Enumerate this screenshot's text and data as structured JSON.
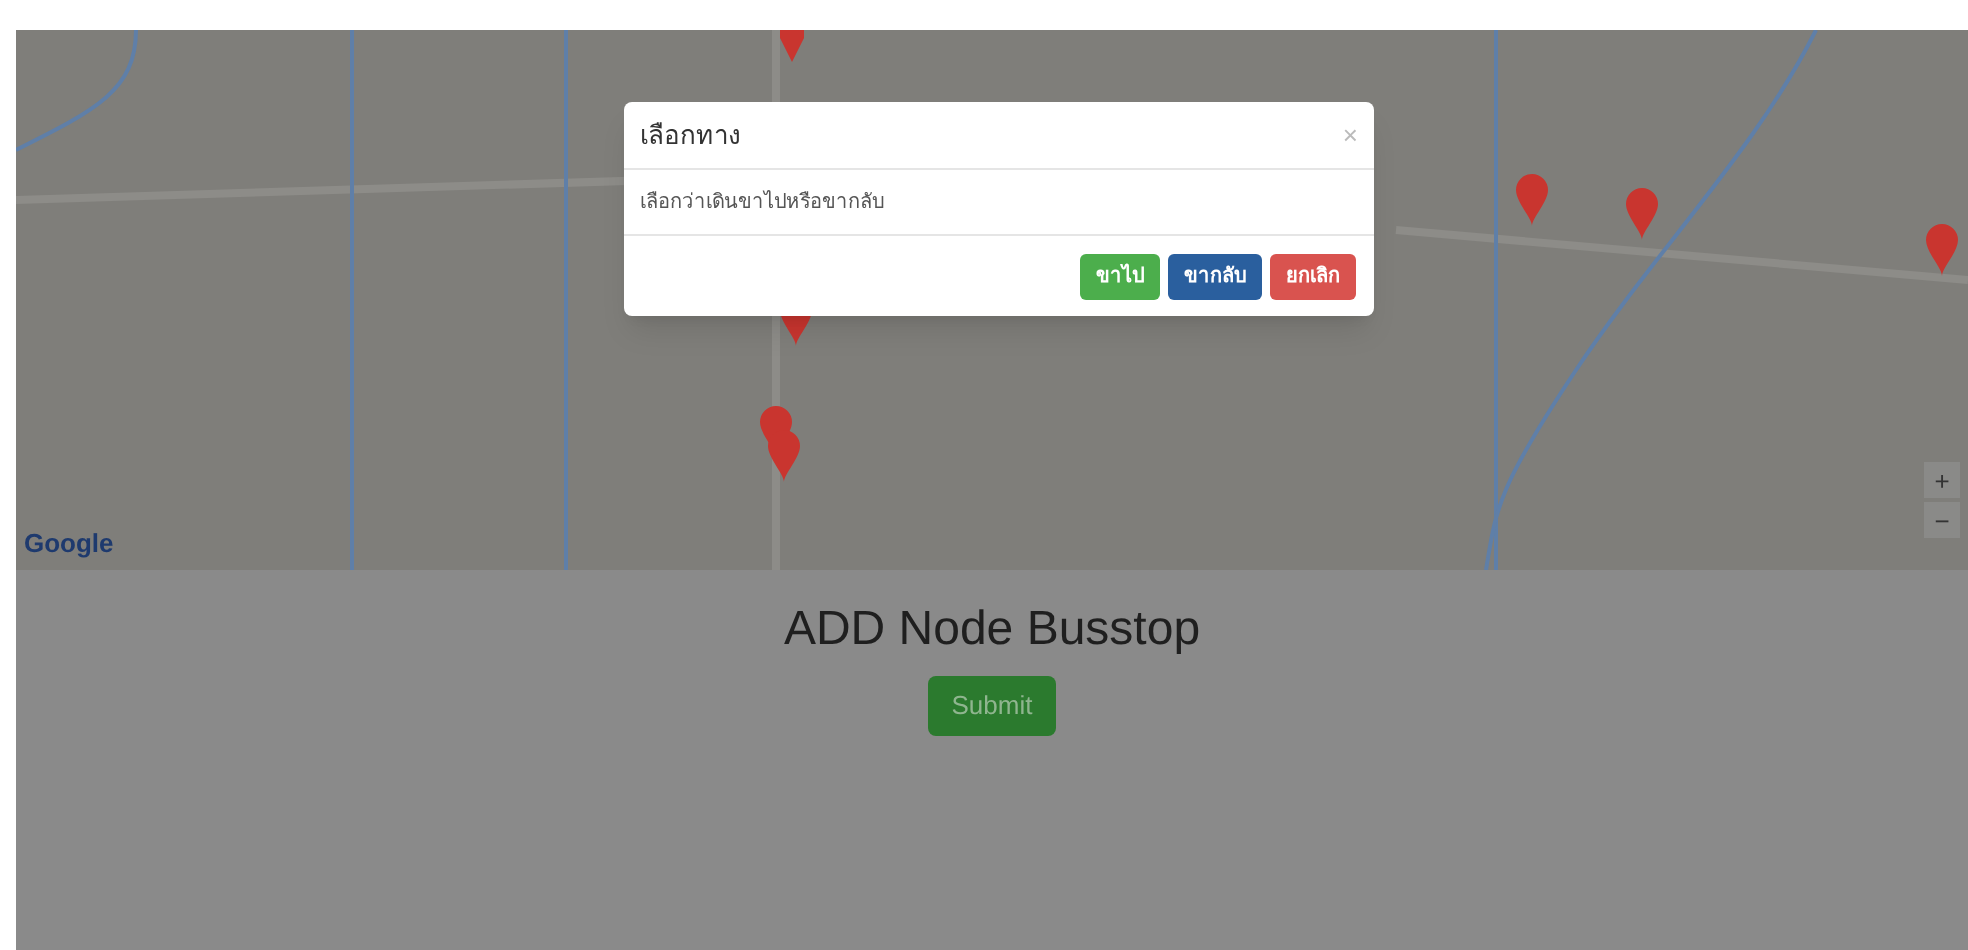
{
  "map": {
    "logo": "Google",
    "zoom_in": "+",
    "zoom_out": "−"
  },
  "dialog": {
    "title": "เลือกทาง",
    "close": "×",
    "message": "เลือกว่าเดินขาไปหรือขากลับ",
    "buttons": [
      {
        "label": "ขาไป",
        "kind": "success"
      },
      {
        "label": "ขากลับ",
        "kind": "primary"
      },
      {
        "label": "ยกเลิก",
        "kind": "danger"
      }
    ]
  },
  "heading": "ADD Node Busstop",
  "submit": "Submit"
}
